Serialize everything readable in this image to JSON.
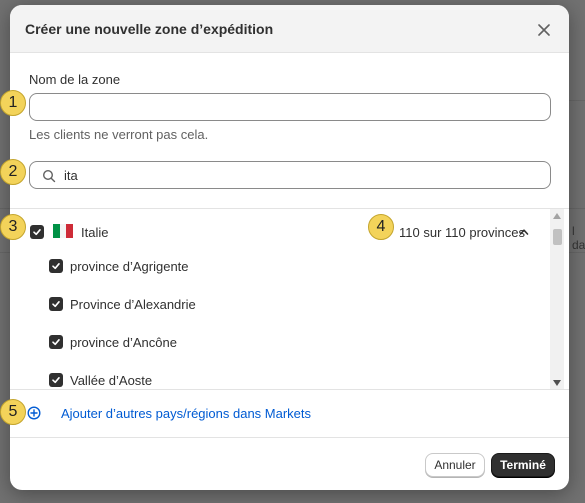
{
  "dialog": {
    "title": "Créer une nouvelle zone d’expédition",
    "close_icon": "close-icon"
  },
  "zone_name": {
    "label": "Nom de la zone",
    "value": "",
    "placeholder": "",
    "help_text": "Les clients ne verront pas cela."
  },
  "search": {
    "value": "ita",
    "icon": "search-icon"
  },
  "country": {
    "name": "Italie",
    "checked": true,
    "flag_colors": [
      "#009246",
      "#ffffff",
      "#ce2b37"
    ],
    "province_count": "110 sur 110 provinces",
    "expanded": true,
    "provinces": [
      {
        "name": "province d’Agrigente",
        "checked": true
      },
      {
        "name": "Province d’Alexandrie",
        "checked": true
      },
      {
        "name": "province d’Ancône",
        "checked": true
      },
      {
        "name": "Vallée d’Aoste",
        "checked": true
      }
    ]
  },
  "add_more": {
    "label": "Ajouter d’autres pays/régions dans Markets",
    "icon": "plus-circle-icon",
    "color": "#005bd3"
  },
  "footer": {
    "cancel_label": "Annuler",
    "done_label": "Terminé"
  },
  "annotations": [
    "1",
    "2",
    "3",
    "4",
    "5"
  ],
  "background": {
    "peek_text": "l da"
  }
}
